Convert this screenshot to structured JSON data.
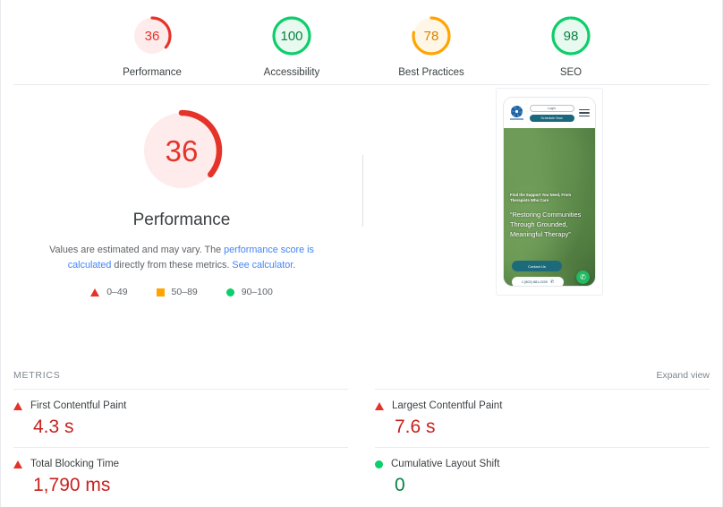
{
  "scores": [
    {
      "value": "36",
      "label": "Performance",
      "color": "#e63329",
      "track": "#fdeceb",
      "pct": 36
    },
    {
      "value": "100",
      "label": "Accessibility",
      "color": "#0cce6b",
      "track": "#e8faf0",
      "pct": 100
    },
    {
      "value": "78",
      "label": "Best Practices",
      "color": "#ffa400",
      "track": "#fff6e5",
      "pct": 78
    },
    {
      "value": "98",
      "label": "SEO",
      "color": "#0cce6b",
      "track": "#e8faf0",
      "pct": 98
    }
  ],
  "performance": {
    "value": "36",
    "title": "Performance",
    "color": "#e63329",
    "track": "#fdeceb",
    "pct": 36,
    "desc_part1": "Values are estimated and may vary. The ",
    "desc_link1": "performance score is calculated",
    "desc_part2": " directly from these metrics. ",
    "desc_link2": "See calculator",
    "desc_part3": "."
  },
  "legend": [
    {
      "marker": "triangle",
      "range": "0–49",
      "color": "#e63329"
    },
    {
      "marker": "square",
      "range": "50–89",
      "color": "#ffa400"
    },
    {
      "marker": "circle",
      "range": "90–100",
      "color": "#0cce6b"
    }
  ],
  "thumbnail": {
    "login_label": "Login",
    "schedule_label": "Schedule Now",
    "hero_kicker": "Find the Support You Need, From Therapists Who Care",
    "hero_quote": "“Restoring Communities Through Grounded, Meaningful Therapy”",
    "cta_label": "Contact Us",
    "phone_number": "1 (802) 881-0200",
    "phone_glyph": "✆",
    "fab_glyph": "✆"
  },
  "metrics_section": {
    "title": "Metrics",
    "expand_label": "Expand view",
    "items": [
      {
        "name": "First Contentful Paint",
        "value": "4.3 s",
        "status": "fail",
        "marker": "triangle"
      },
      {
        "name": "Largest Contentful Paint",
        "value": "7.6 s",
        "status": "fail",
        "marker": "triangle"
      },
      {
        "name": "Total Blocking Time",
        "value": "1,790 ms",
        "status": "fail",
        "marker": "triangle"
      },
      {
        "name": "Cumulative Layout Shift",
        "value": "0",
        "status": "pass",
        "marker": "circle"
      }
    ]
  }
}
